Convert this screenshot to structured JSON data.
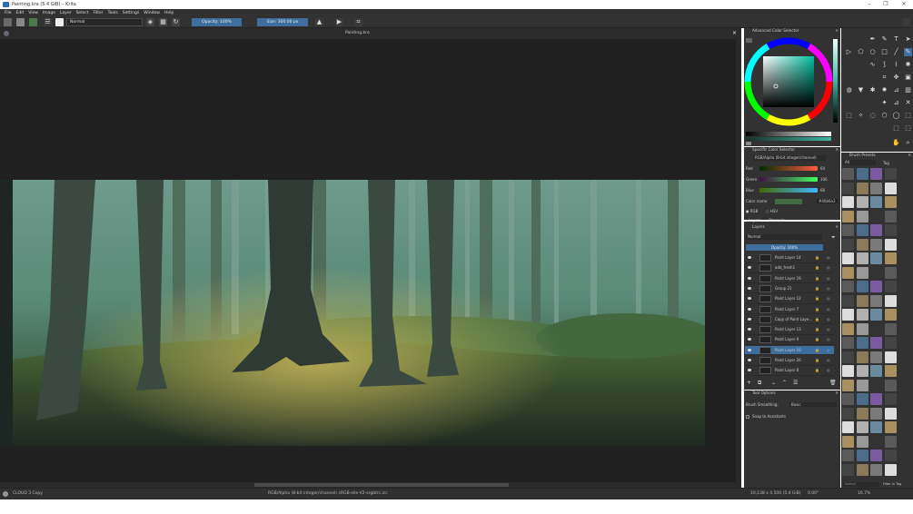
{
  "window": {
    "title": "Painting.kra (5.4 GiB) – Krita",
    "buttons": [
      "–",
      "❐",
      "✕"
    ]
  },
  "menu": [
    "File",
    "Edit",
    "View",
    "Image",
    "Layer",
    "Select",
    "Filter",
    "Tools",
    "Settings",
    "Window",
    "Help"
  ],
  "toolbar": {
    "blend_mode": "Normal",
    "opacity": "Opacity: 100%",
    "size": "Size: 300.00 px"
  },
  "document": {
    "title": "Painting.kra"
  },
  "dockers": {
    "advanced_color_selector": "Advanced Color Selector",
    "specific_color_selector": "Specific Color Selector",
    "color_model": "RGB/Alpha (8-bit integer/channel)",
    "channels": [
      {
        "name": "Red",
        "value": "64"
      },
      {
        "name": "Green",
        "value": "106"
      },
      {
        "name": "Blue",
        "value": "66"
      }
    ],
    "color_name_label": "Color name:",
    "hex_value": "#40b6a3",
    "rgb_label": "RGB",
    "hsv_label": "HSV",
    "layers_tab": "Layers",
    "channels_tab": "Channels",
    "layers_title": "Layers",
    "layer_blend": "Normal",
    "layer_opacity": "Opacity: 100%",
    "layers": [
      "Paint Layer 14",
      "add_fresh1",
      "Paint Layer 19",
      "Group 21",
      "Paint Layer 12",
      "Paint Layer 7",
      "Copy of Paint Laye...",
      "Paint Layer 13",
      "Paint Layer 9",
      "Paint Layer 10",
      "Paint Layer 20",
      "Paint Layer 8"
    ],
    "selected_layer_index": 9,
    "tool_options": "Tool Options",
    "brush_smoothing_label": "Brush Smoothing:",
    "brush_smoothing_value": "Basic",
    "snap_label": "Snap to Assistants",
    "brush_presets": "Brush Presets",
    "brush_tag": "All",
    "tag_label": "Tag",
    "search_placeholder": "Search",
    "filter_in_tag": "Filter in Tag"
  },
  "status": {
    "brush": "CLOUD 3 Copy",
    "color_info": "RGB/Alpha (8-bit integer/channel)  sRGB-elle-V2-srgbtrc.icc",
    "dimensions": "10,138 x 4,500 (5.4 GiB)",
    "rotation": "0.00°",
    "zoom": "16.7%"
  },
  "colors": {
    "accent": "#3d6e9d",
    "panel": "#323232",
    "canvas_bg": "#202020"
  }
}
